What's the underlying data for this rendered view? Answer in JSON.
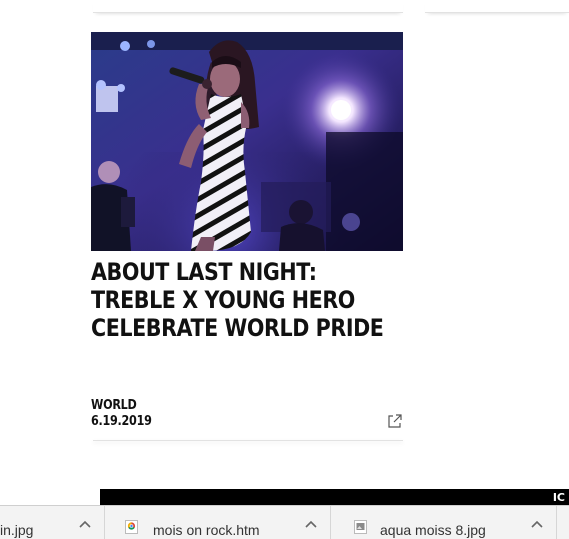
{
  "article": {
    "title": "About Last Night: Treble X Young Hero Celebrate World Pride",
    "category": "WORLD",
    "date": "6.19.2019"
  },
  "icons": {
    "share": "share-icon",
    "chevron": "chevron-up-icon",
    "chrome_file": "chrome-document-icon",
    "image_file": "image-file-icon"
  },
  "colors": {
    "title_text": "#111111",
    "next_card_bg": "#000000",
    "shelf_bg": "#f3f3f3"
  },
  "next_card": {
    "glyph": "IC"
  },
  "downloads": [
    {
      "name": "in.jpg"
    },
    {
      "name": "mois on rock.htm"
    },
    {
      "name": "aqua moiss 8.jpg"
    }
  ]
}
